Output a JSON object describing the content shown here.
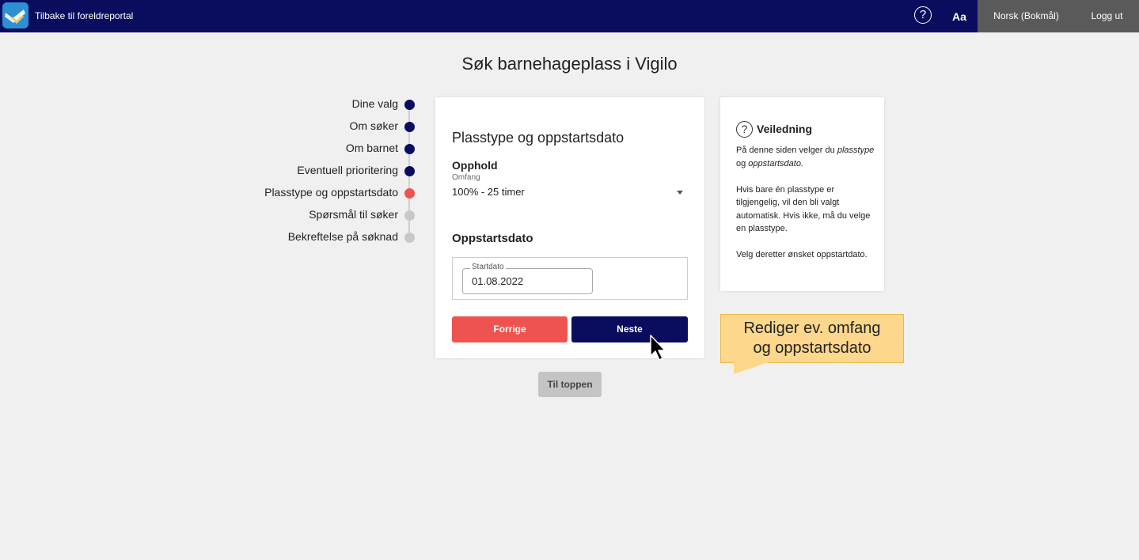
{
  "topbar": {
    "back_label": "Tilbake til foreldreportal",
    "help_symbol": "?",
    "font_label": "Aa",
    "language_label": "Norsk (Bokmål)",
    "logout_label": "Logg ut",
    "logo_icon": "vigilo-logo-icon"
  },
  "page": {
    "title": "Søk barnehageplass i Vigilo"
  },
  "steps": [
    {
      "label": "Dine valg",
      "state": "done",
      "color": "#0a0d5e"
    },
    {
      "label": "Om søker",
      "state": "done",
      "color": "#0a0d5e"
    },
    {
      "label": "Om barnet",
      "state": "done",
      "color": "#0a0d5e"
    },
    {
      "label": "Eventuell prioritering",
      "state": "done",
      "color": "#0a0d5e"
    },
    {
      "label": "Plasstype og oppstartsdato",
      "state": "current",
      "color": "#ef5350"
    },
    {
      "label": "Spørsmål til søker",
      "state": "todo",
      "color": "#c8c8c8"
    },
    {
      "label": "Bekreftelse på søknad",
      "state": "todo",
      "color": "#c8c8c8"
    }
  ],
  "form": {
    "section_title": "Plasstype og oppstartsdato",
    "opphold_label": "Opphold",
    "omfang_label": "Omfang",
    "omfang_value": "100% - 25 timer",
    "startdate_title": "Oppstartsdato",
    "startdate_field_label": "Startdato",
    "startdate_value": "01.08.2022",
    "prev_label": "Forrige",
    "next_label": "Neste"
  },
  "guide": {
    "symbol": "?",
    "title": "Veiledning",
    "p1_pre": "På denne siden velger du ",
    "p1_em1": "plasstype",
    "p1_mid": " og ",
    "p1_em2": "oppstartsdato.",
    "p2": "Hvis bare én plasstype er tilgjengelig, vil den bli valgt automatisk. Hvis ikke, må du velge en plasstype.",
    "p3": "Velg deretter ønsket oppstartdato."
  },
  "to_top_label": "Til toppen",
  "callout": {
    "line1": "Rediger ev. omfang",
    "line2": "og oppstartsdato"
  },
  "colors": {
    "navy": "#0a0d5e",
    "red": "#ef5350",
    "callout": "#fdd78b"
  }
}
